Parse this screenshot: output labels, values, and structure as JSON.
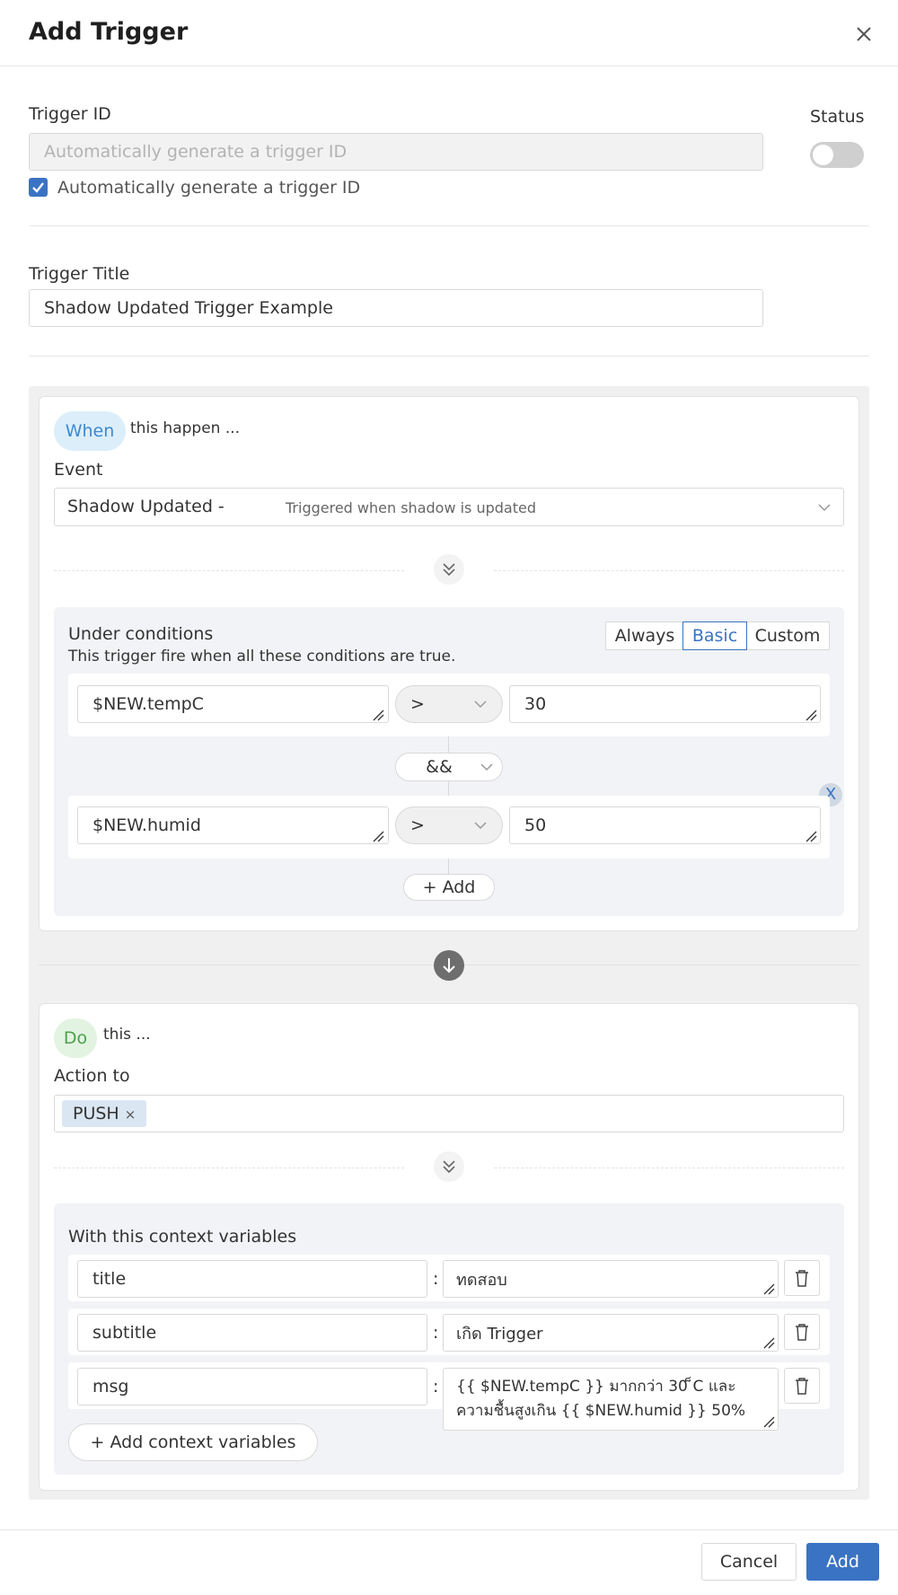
{
  "dialog": {
    "title": "Add Trigger"
  },
  "trigger_id": {
    "label": "Trigger ID",
    "placeholder": "Automatically generate a trigger ID",
    "auto_generate_checked": true,
    "auto_generate_label": "Automatically generate a trigger ID"
  },
  "status": {
    "label": "Status",
    "enabled": false
  },
  "trigger_title": {
    "label": "Trigger Title",
    "value": "Shadow Updated Trigger Example"
  },
  "when": {
    "pill": "When",
    "caption": "this happen ...",
    "event_label": "Event",
    "event_value": "Shadow Updated - ",
    "event_description": "Triggered when shadow is updated"
  },
  "conditions": {
    "title": "Under conditions",
    "subtitle": "This trigger fire when all these conditions are true.",
    "modes": [
      "Always",
      "Basic",
      "Custom"
    ],
    "active_mode": "Basic",
    "rows": [
      {
        "left": "$NEW.tempC",
        "op": ">",
        "right": "30"
      },
      {
        "left": "$NEW.humid",
        "op": ">",
        "right": "50"
      }
    ],
    "joiner": "&&",
    "remove_label": "X",
    "add_label": "Add"
  },
  "do": {
    "pill": "Do",
    "caption": "this ...",
    "action_label": "Action to",
    "tags": [
      "PUSH"
    ],
    "tag_remove": "×"
  },
  "context": {
    "title": "With this context variables",
    "rows": [
      {
        "key": "title",
        "value": "ทดสอบ"
      },
      {
        "key": "subtitle",
        "value": "เกิด Trigger"
      },
      {
        "key": "msg",
        "value": "{{  $NEW.tempC }} มากกว่า 30 ็C และความชื้นสูงเกิน  {{ $NEW.humid }} 50%"
      }
    ],
    "separator": ":",
    "add_label": "Add context variables"
  },
  "footer": {
    "cancel_label": "Cancel",
    "add_label": "Add"
  },
  "colors": {
    "accent": "#3a73c3",
    "when_pill_bg": "#dbeefa",
    "do_pill_bg": "#e3f3e1",
    "panel_bg": "#f2f3f6"
  },
  "icons": [
    "close-icon",
    "checkmark-icon",
    "chevron-down-icon",
    "double-chevron-down-icon",
    "arrow-down-icon",
    "trash-icon",
    "plus-icon",
    "resize-grip-icon"
  ]
}
